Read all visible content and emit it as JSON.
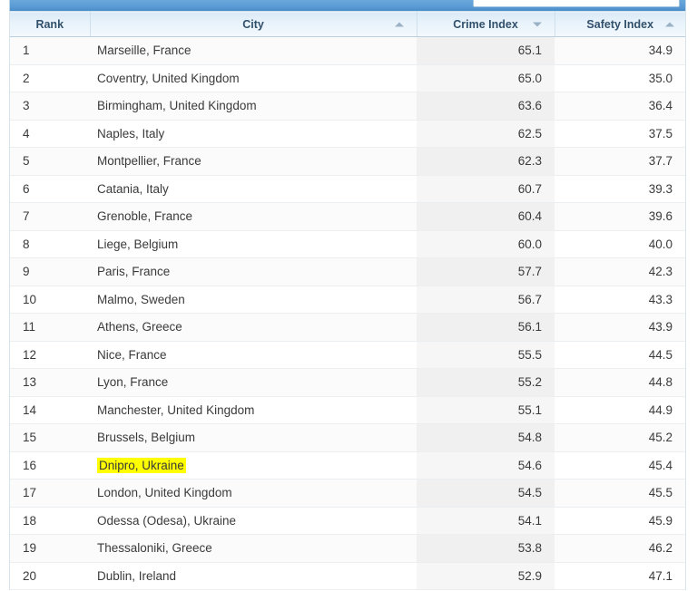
{
  "toolbar": {
    "search_value": "",
    "search_placeholder": "",
    "bar_color": "#5b9bd5"
  },
  "table": {
    "columns": [
      {
        "key": "rank",
        "label": "Rank",
        "sort": "none",
        "align": "left"
      },
      {
        "key": "city",
        "label": "City",
        "sort": "asc",
        "align": "left"
      },
      {
        "key": "crime",
        "label": "Crime Index",
        "sort": "desc",
        "align": "right"
      },
      {
        "key": "safety",
        "label": "Safety Index",
        "sort": "asc",
        "align": "right"
      }
    ],
    "sorted_column": "crime",
    "sorted_direction": "desc",
    "highlight_color": "#ffff00",
    "highlighted_row_rank": "16",
    "rows": [
      {
        "rank": "1",
        "city": "Marseille, France",
        "crime": "65.1",
        "safety": "34.9",
        "highlighted": false
      },
      {
        "rank": "2",
        "city": "Coventry, United Kingdom",
        "crime": "65.0",
        "safety": "35.0",
        "highlighted": false
      },
      {
        "rank": "3",
        "city": "Birmingham, United Kingdom",
        "crime": "63.6",
        "safety": "36.4",
        "highlighted": false
      },
      {
        "rank": "4",
        "city": "Naples, Italy",
        "crime": "62.5",
        "safety": "37.5",
        "highlighted": false
      },
      {
        "rank": "5",
        "city": "Montpellier, France",
        "crime": "62.3",
        "safety": "37.7",
        "highlighted": false
      },
      {
        "rank": "6",
        "city": "Catania, Italy",
        "crime": "60.7",
        "safety": "39.3",
        "highlighted": false
      },
      {
        "rank": "7",
        "city": "Grenoble, France",
        "crime": "60.4",
        "safety": "39.6",
        "highlighted": false
      },
      {
        "rank": "8",
        "city": "Liege, Belgium",
        "crime": "60.0",
        "safety": "40.0",
        "highlighted": false
      },
      {
        "rank": "9",
        "city": "Paris, France",
        "crime": "57.7",
        "safety": "42.3",
        "highlighted": false
      },
      {
        "rank": "10",
        "city": "Malmo, Sweden",
        "crime": "56.7",
        "safety": "43.3",
        "highlighted": false
      },
      {
        "rank": "11",
        "city": "Athens, Greece",
        "crime": "56.1",
        "safety": "43.9",
        "highlighted": false
      },
      {
        "rank": "12",
        "city": "Nice, France",
        "crime": "55.5",
        "safety": "44.5",
        "highlighted": false
      },
      {
        "rank": "13",
        "city": "Lyon, France",
        "crime": "55.2",
        "safety": "44.8",
        "highlighted": false
      },
      {
        "rank": "14",
        "city": "Manchester, United Kingdom",
        "crime": "55.1",
        "safety": "44.9",
        "highlighted": false
      },
      {
        "rank": "15",
        "city": "Brussels, Belgium",
        "crime": "54.8",
        "safety": "45.2",
        "highlighted": false
      },
      {
        "rank": "16",
        "city": "Dnipro, Ukraine",
        "crime": "54.6",
        "safety": "45.4",
        "highlighted": true
      },
      {
        "rank": "17",
        "city": "London, United Kingdom",
        "crime": "54.5",
        "safety": "45.5",
        "highlighted": false
      },
      {
        "rank": "18",
        "city": "Odessa (Odesa), Ukraine",
        "crime": "54.1",
        "safety": "45.9",
        "highlighted": false
      },
      {
        "rank": "19",
        "city": "Thessaloniki, Greece",
        "crime": "53.8",
        "safety": "46.2",
        "highlighted": false
      },
      {
        "rank": "20",
        "city": "Dublin, Ireland",
        "crime": "52.9",
        "safety": "47.1",
        "highlighted": false
      }
    ]
  }
}
